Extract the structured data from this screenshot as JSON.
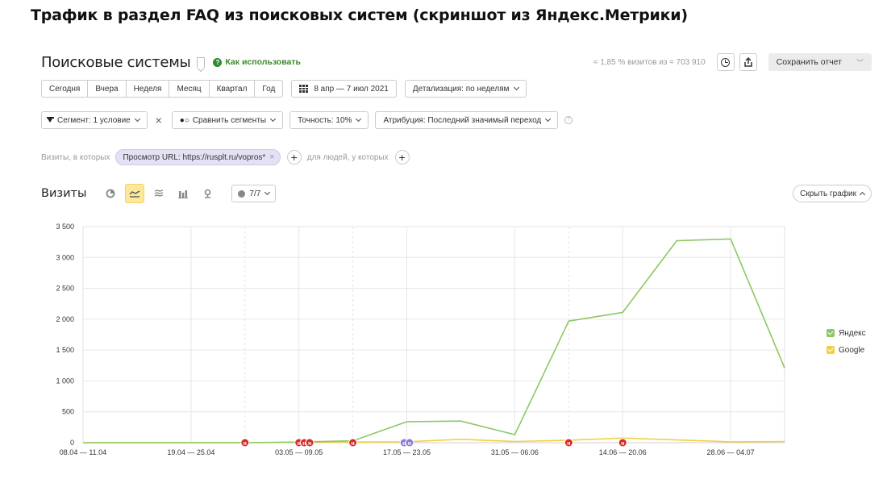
{
  "caption": "Трафик в раздел FAQ из поисковых систем (скриншот из Яндекс.Метрики)",
  "header": {
    "title": "Поисковые системы",
    "howto": "Как использовать",
    "visits_share": "≈ 1,85 % визитов из ≈ 703 910",
    "save_label": "Сохранить отчет"
  },
  "periods": [
    "Сегодня",
    "Вчера",
    "Неделя",
    "Месяц",
    "Квартал",
    "Год"
  ],
  "date_range": "8 апр — 7 июл 2021",
  "detail": "Детализация: по неделям",
  "filters": {
    "segment": "Сегмент: 1 условие",
    "compare": "Сравнить сегменты",
    "accuracy": "Точность: 10%",
    "attribution": "Атрибуция: Последний значимый переход"
  },
  "conditions": {
    "prefix": "Визиты, в которых",
    "chip": "Просмотр URL: https://rusplt.ru/vopros*",
    "people": "для людей, у которых"
  },
  "chart_header": {
    "title": "Визиты",
    "series_count": "7/7",
    "hide_label": "Скрыть график"
  },
  "colors": {
    "yandex": "#8cc865",
    "google": "#f4d03f",
    "marker_red": "#d52b2b",
    "marker_purple": "#8d7ad6"
  },
  "chart_data": {
    "type": "line",
    "title": "",
    "ylim": [
      0,
      3500
    ],
    "yticks": [
      0,
      500,
      1000,
      1500,
      2000,
      2500,
      3000,
      3500
    ],
    "ytick_labels": [
      "0",
      "500",
      "1 000",
      "1 500",
      "2 000",
      "2 500",
      "3 000",
      "3 500"
    ],
    "xtick_labels": [
      "08.04 — 11.04",
      "19.04 — 25.04",
      "03.05 — 09.05",
      "17.05 — 23.05",
      "31.05 — 06.06",
      "14.06 — 20.06",
      "28.06 — 04.07"
    ],
    "x": [
      0,
      1,
      2,
      3,
      4,
      5,
      6,
      7,
      8,
      9,
      10,
      11,
      12,
      13
    ],
    "series": [
      {
        "name": "Яндекс",
        "values": [
          0,
          0,
          0,
          0,
          10,
          30,
          340,
          350,
          130,
          1970,
          2110,
          3270,
          3300,
          1210
        ]
      },
      {
        "name": "Google",
        "values": [
          0,
          0,
          0,
          0,
          5,
          10,
          15,
          55,
          20,
          40,
          75,
          45,
          15,
          20
        ]
      }
    ],
    "markers": [
      {
        "x": 3.0,
        "label": "н",
        "color": "red"
      },
      {
        "x": 4.0,
        "label": "н",
        "color": "red"
      },
      {
        "x": 4.1,
        "label": "н",
        "color": "red"
      },
      {
        "x": 4.2,
        "label": "н",
        "color": "red"
      },
      {
        "x": 5.0,
        "label": "н",
        "color": "red"
      },
      {
        "x": 5.95,
        "label": "н",
        "color": "purple"
      },
      {
        "x": 6.05,
        "label": "н",
        "color": "purple"
      },
      {
        "x": 9.0,
        "label": "н",
        "color": "red"
      },
      {
        "x": 10.0,
        "label": "н",
        "color": "red"
      }
    ],
    "legend_position": "right",
    "grid": true
  }
}
